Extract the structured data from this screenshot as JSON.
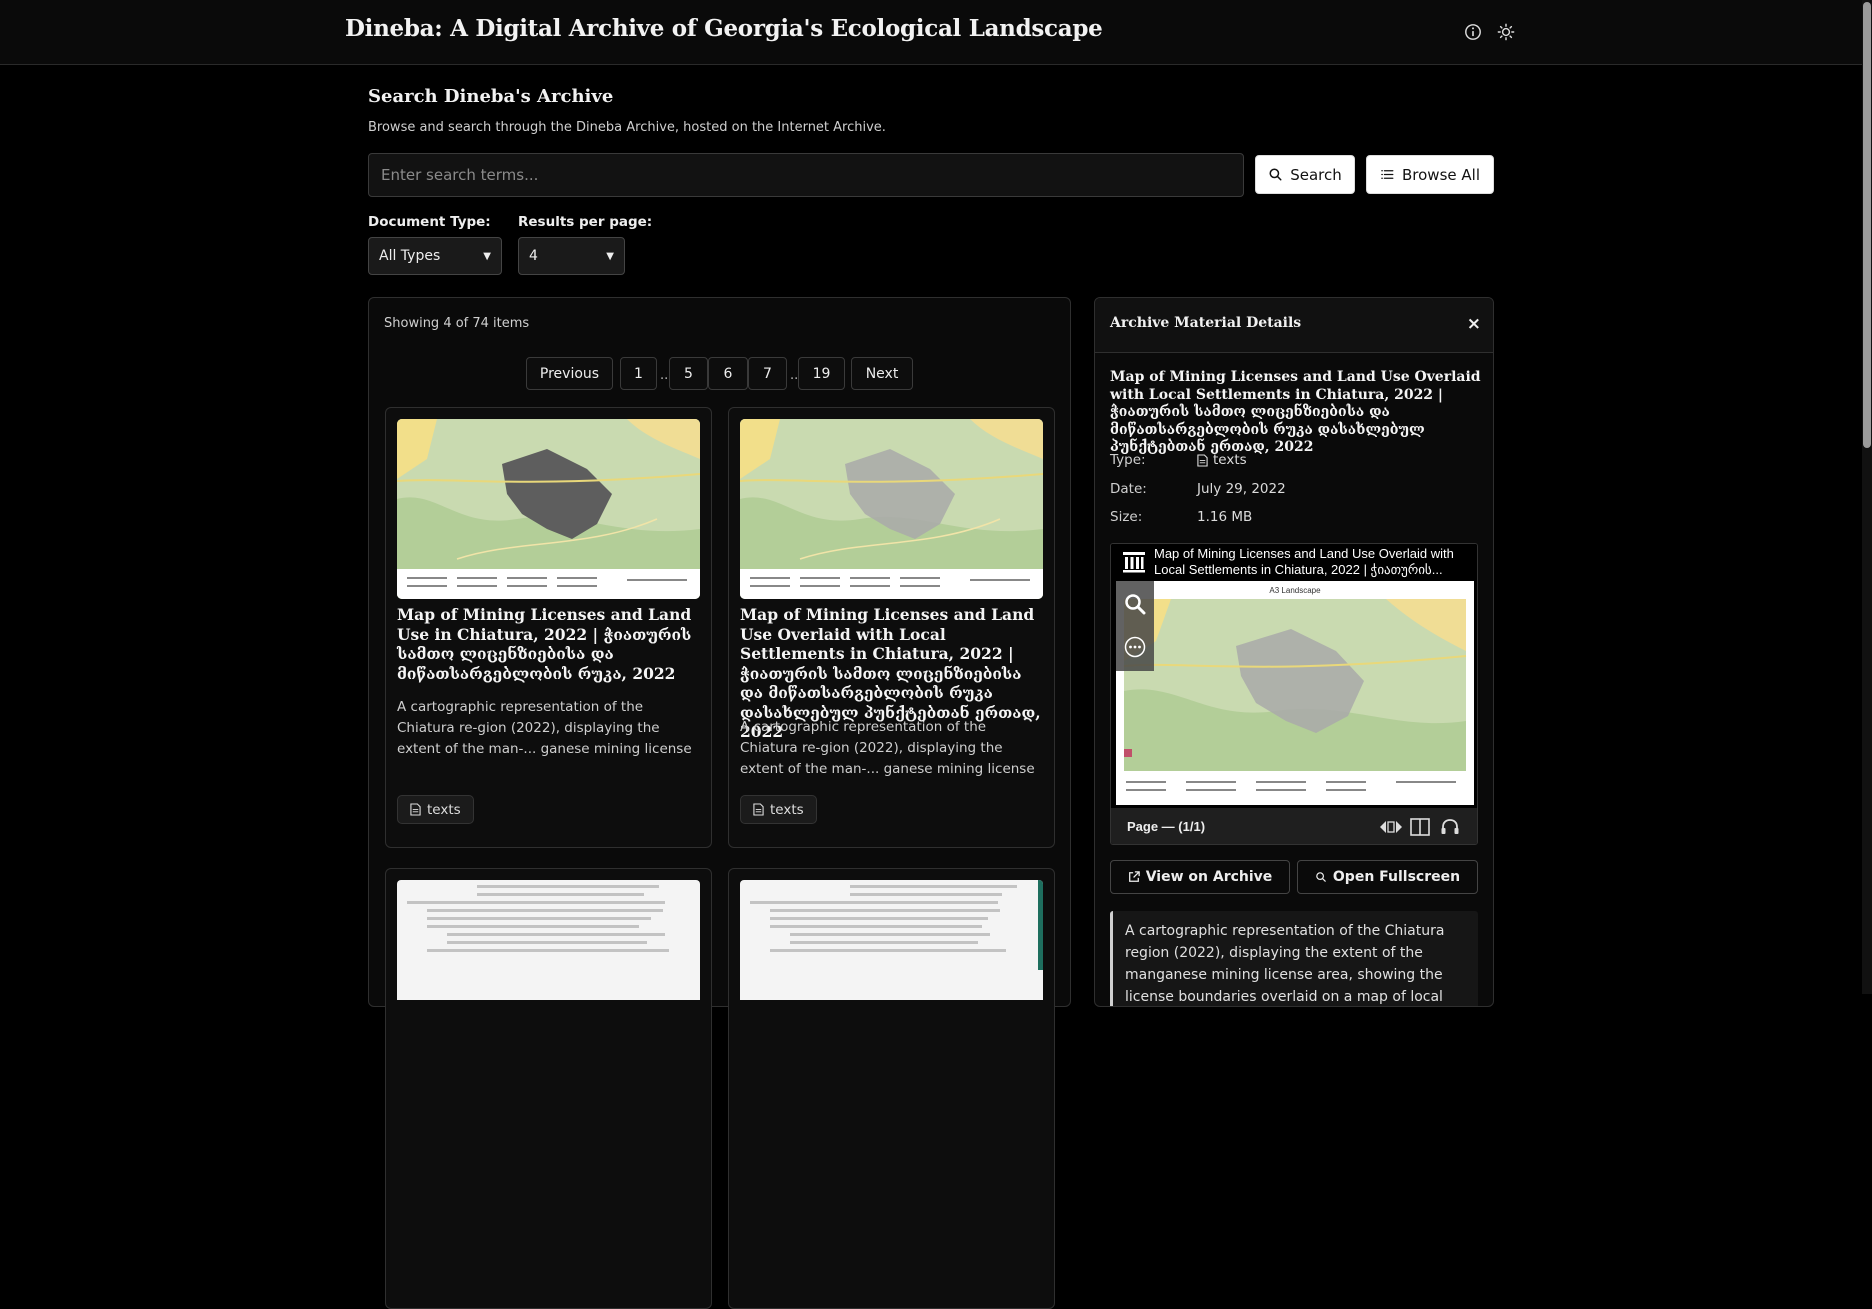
{
  "header": {
    "title": "Dineba: A Digital Archive of Georgia's Ecological Landscape"
  },
  "search": {
    "heading": "Search Dineba's Archive",
    "subtitle": "Browse and search through the Dineba Archive, hosted on the Internet Archive.",
    "placeholder": "Enter search terms...",
    "search_label": "Search",
    "browse_label": "Browse All",
    "doc_type_label": "Document Type:",
    "doc_type_value": "All Types",
    "per_page_label": "Results per page:",
    "per_page_value": "4"
  },
  "results": {
    "showing": "Showing 4 of 74 items",
    "pagination": {
      "previous": "Previous",
      "next": "Next",
      "pages": [
        "1",
        "5",
        "6",
        "7",
        "19"
      ],
      "ellipsis": "..."
    },
    "cards": [
      {
        "title": "Map of Mining Licenses and Land Use in Chiatura, 2022 | ჭიათურის სამთო ლიცენზიებისა და მიწათსარგებლობის რუკა, 2022",
        "description": "A cartographic representation of the Chiatura re-gion (2022), displaying the extent of the man-... ganese mining license area. ჭიათურის",
        "tag": "texts"
      },
      {
        "title": "Map of Mining Licenses and Land Use Overlaid with Local Settlements in Chiatura, 2022 | ჭიათურის სამთო ლიცენზიებისა და მიწათსარგებლობის რუკა დასახლებულ პუნქტებთან ერთად, 2022",
        "description": "A cartographic representation of the Chiatura re-gion (2022), displaying the extent of the man-... ganese mining license area, showing the license",
        "tag": "texts"
      }
    ]
  },
  "details": {
    "heading": "Archive Material Details",
    "close": "×",
    "title": "Map of Mining Licenses and Land Use Overlaid with Local Settlements in Chiatura, 2022 | ჭიათურის სამთო ლიცენზიებისა და მიწათსარგებლობის რუკა დასახლებულ პუნქტებთან ერთად, 2022",
    "type_label": "Type:",
    "type_value": "texts",
    "date_label": "Date:",
    "date_value": "July 29, 2022",
    "size_label": "Size:",
    "size_value": "1.16 MB",
    "viewer": {
      "title": "Map of Mining Licenses and Land Use Overlaid with Local Settlements in Chiatura, 2022 | ჭიათურის...",
      "map_heading": "A3 Landscape",
      "page_label": "Page — (1/1)"
    },
    "view_archive_label": "View on Archive",
    "fullscreen_label": "Open Fullscreen",
    "description": "A cartographic representation of the Chiatura region (2022), displaying the extent of the manganese mining license area, showing the license boundaries overlaid on a map of local settlements, highlighting the village"
  }
}
